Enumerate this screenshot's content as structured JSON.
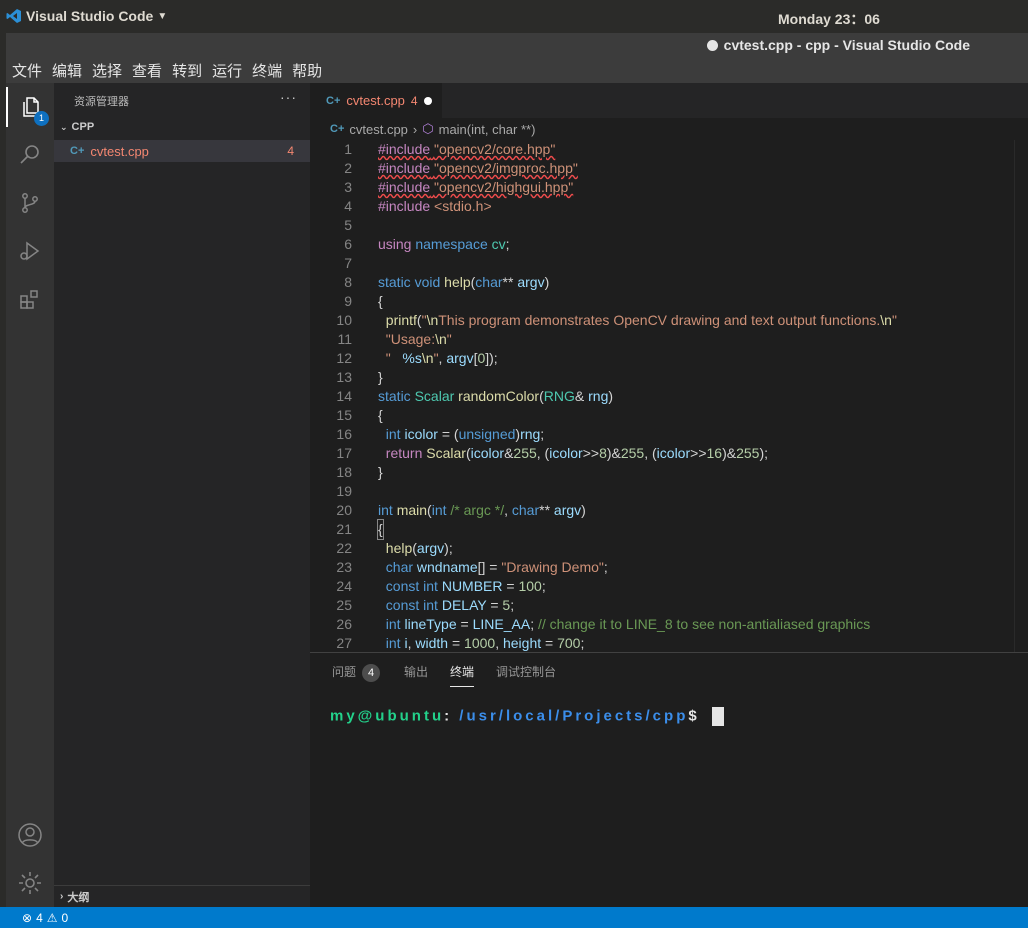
{
  "topbar": {
    "app_name": "Visual Studio Code",
    "clock": "Monday 23：06"
  },
  "window": {
    "title": "cvtest.cpp - cpp - Visual Studio Code"
  },
  "menu": [
    "文件",
    "编辑",
    "选择",
    "查看",
    "转到",
    "运行",
    "终端",
    "帮助"
  ],
  "activity": {
    "explorer_badge": "1"
  },
  "sidebar": {
    "title": "资源管理器",
    "more": "···",
    "folder": "CPP",
    "file": {
      "icon_text": "C+",
      "name": "cvtest.cpp",
      "count": "4"
    },
    "outline": "大纲"
  },
  "tab": {
    "icon_text": "C+",
    "name": "cvtest.cpp",
    "count": "4"
  },
  "breadcrumb": {
    "file": "cvtest.cpp",
    "symbol": "main(int, char **)"
  },
  "line_numbers": [
    "1",
    "2",
    "3",
    "4",
    "5",
    "6",
    "7",
    "8",
    "9",
    "10",
    "11",
    "12",
    "13",
    "14",
    "15",
    "16",
    "17",
    "18",
    "19",
    "20",
    "21",
    "22",
    "23",
    "24",
    "25",
    "26",
    "27"
  ],
  "panel": {
    "tabs": [
      "问题",
      "输出",
      "终端",
      "调试控制台"
    ],
    "problems_count": "4",
    "terminal": {
      "user": "my@ubuntu",
      "sep": ":",
      "path": "/usr/local/Projects/cpp",
      "prompt": "$"
    }
  },
  "status": {
    "errors": "4",
    "warnings": "0"
  }
}
